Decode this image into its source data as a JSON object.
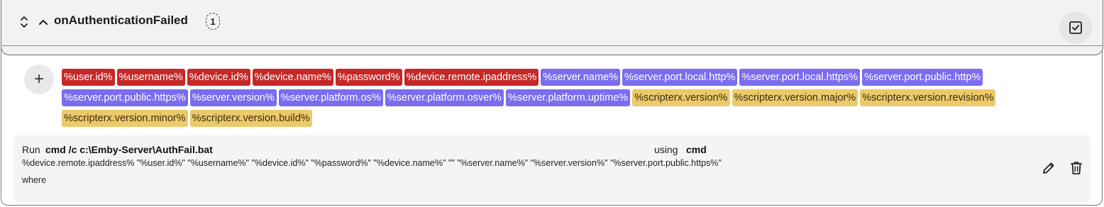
{
  "header": {
    "title": "onAuthenticationFailed",
    "count": "1"
  },
  "icons": {
    "expand": "expand-collapse-icon",
    "chevron": "chevron-up-icon",
    "check": "checkbox-check-icon",
    "add": "plus-icon",
    "edit": "pencil-icon",
    "delete": "trash-icon"
  },
  "add_label": "+",
  "tags": {
    "row1": [
      {
        "label": "%user.id%",
        "kind": "user"
      },
      {
        "label": "%username%",
        "kind": "user"
      },
      {
        "label": "%device.id%",
        "kind": "user"
      },
      {
        "label": "%device.name%",
        "kind": "user"
      },
      {
        "label": "%password%",
        "kind": "user"
      },
      {
        "label": "%device.remote.ipaddress%",
        "kind": "user"
      },
      {
        "label": "%server.name%",
        "kind": "server"
      },
      {
        "label": "%server.port.local.http%",
        "kind": "server"
      },
      {
        "label": "%server.port.local.https%",
        "kind": "server"
      },
      {
        "label": "%server.port.public.http%",
        "kind": "server"
      }
    ],
    "row2": [
      {
        "label": "%server.port.public.https%",
        "kind": "server"
      },
      {
        "label": "%server.version%",
        "kind": "server"
      },
      {
        "label": "%server.platform.os%",
        "kind": "server"
      },
      {
        "label": "%server.platform.osver%",
        "kind": "server"
      },
      {
        "label": "%server.platform.uptime%",
        "kind": "server"
      },
      {
        "label": "%scripterx.version%",
        "kind": "script"
      },
      {
        "label": "%scripterx.version.major%",
        "kind": "script"
      },
      {
        "label": "%scripterx.version.revision%",
        "kind": "script"
      }
    ],
    "row3": [
      {
        "label": "%scripterx.version.minor%",
        "kind": "script"
      },
      {
        "label": "%scripterx.version.build%",
        "kind": "script"
      }
    ]
  },
  "colors": {
    "user": "#c62828",
    "server": "#7b6cf0",
    "script": "#ecc96a"
  },
  "command": {
    "run_label": "Run",
    "run_value": "cmd /c c:\\Emby-Server\\AuthFail.bat",
    "using_label": "using",
    "using_value": "cmd",
    "args": "%device.remote.ipaddress% \"%user.id%\" \"%username%\" \"%device.id%\" \"%password%\" \"%device.name%\" \"\" \"%server.name%\" \"%server.version%\" \"%server.port.public.https%\"",
    "where_label": "where"
  }
}
